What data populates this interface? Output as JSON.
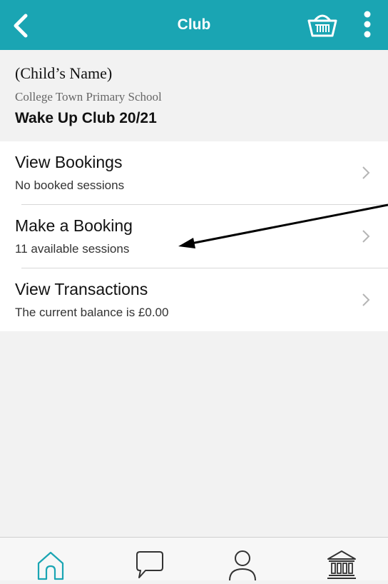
{
  "header": {
    "title": "Club",
    "back_icon": "chevron-left-icon",
    "basket_icon": "basket-icon",
    "more_icon": "more-vertical-icon",
    "background_color": "#1aa5b3"
  },
  "info": {
    "child_name": "(Child’s Name)",
    "school_name": "College Town Primary School",
    "club_name": "Wake Up Club 20/21"
  },
  "menu": {
    "items": [
      {
        "title": "View Bookings",
        "subtitle": "No booked sessions"
      },
      {
        "title": "Make a Booking",
        "subtitle": "11 available sessions"
      },
      {
        "title": "View Transactions",
        "subtitle": "The current balance is £0.00"
      }
    ]
  },
  "tabs": [
    {
      "icon": "home-icon",
      "active": true
    },
    {
      "icon": "chat-icon",
      "active": false
    },
    {
      "icon": "profile-icon",
      "active": false
    },
    {
      "icon": "bank-icon",
      "active": false
    }
  ],
  "accent_color": "#1aa5b3"
}
